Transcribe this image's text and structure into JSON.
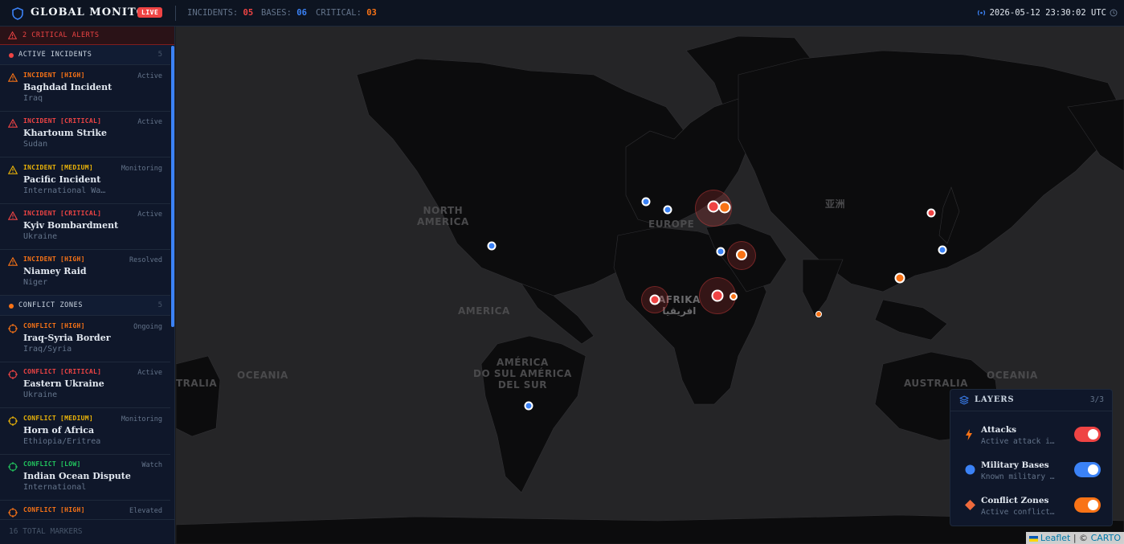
{
  "header": {
    "title": "GLOBAL MONITOR",
    "live": "LIVE",
    "stats": [
      {
        "label": "INCIDENTS:",
        "value": "05",
        "color": "#ef4444"
      },
      {
        "label": "BASES:",
        "value": "06",
        "color": "#3b82f6"
      },
      {
        "label": "CRITICAL:",
        "value": "03",
        "color": "#f97316"
      }
    ],
    "clock": "2026-05-12 23:30:02 UTC"
  },
  "sidebar": {
    "alerts": "2 CRITICAL ALERTS",
    "incidents_section": {
      "label": "ACTIVE INCIDENTS",
      "count": "5",
      "color": "#ef4444"
    },
    "incidents": [
      {
        "tag": "INCIDENT [HIGH]",
        "name": "Baghdad Incident",
        "loc": "Iraq",
        "status": "Active",
        "color": "#f97316"
      },
      {
        "tag": "INCIDENT [CRITICAL]",
        "name": "Khartoum Strike",
        "loc": "Sudan",
        "status": "Active",
        "color": "#ef4444"
      },
      {
        "tag": "INCIDENT [MEDIUM]",
        "name": "Pacific Incident",
        "loc": "International Wa…",
        "status": "Monitoring",
        "color": "#eab308"
      },
      {
        "tag": "INCIDENT [CRITICAL]",
        "name": "Kyiv Bombardment",
        "loc": "Ukraine",
        "status": "Active",
        "color": "#ef4444"
      },
      {
        "tag": "INCIDENT [HIGH]",
        "name": "Niamey Raid",
        "loc": "Niger",
        "status": "Resolved",
        "color": "#f97316"
      }
    ],
    "conflicts_section": {
      "label": "CONFLICT ZONES",
      "count": "5",
      "color": "#f97316"
    },
    "conflicts": [
      {
        "tag": "CONFLICT [HIGH]",
        "name": "Iraq-Syria Border",
        "loc": "Iraq/Syria",
        "status": "Ongoing",
        "color": "#f97316"
      },
      {
        "tag": "CONFLICT [CRITICAL]",
        "name": "Eastern Ukraine",
        "loc": "Ukraine",
        "status": "Active",
        "color": "#ef4444"
      },
      {
        "tag": "CONFLICT [MEDIUM]",
        "name": "Horn of Africa",
        "loc": "Ethiopia/Eritrea",
        "status": "Monitoring",
        "color": "#eab308"
      },
      {
        "tag": "CONFLICT [LOW]",
        "name": "Indian Ocean Dispute",
        "loc": "International",
        "status": "Watch",
        "color": "#22c55e"
      },
      {
        "tag": "CONFLICT [HIGH]",
        "name": "",
        "loc": "",
        "status": "Elevated",
        "color": "#f97316"
      }
    ],
    "footer": "16 TOTAL MARKERS"
  },
  "map": {
    "labels": {
      "north_america": "NORTH\nAMERICA",
      "europe": "EUROPE",
      "asia": "亚洲",
      "america": "AMERICA",
      "afrika": "AFRIKA\nافريقيا",
      "south_america": "AMÉRICA\nDO SUL AMÉRICA\nDEL SUR",
      "oceania_left": "OCEANIA",
      "australia_left": "TRALIA",
      "australia": "AUSTRALIA",
      "oceania_right": "OCEANIA"
    },
    "attribution": {
      "leaflet": "Leaflet",
      "sep": " | © ",
      "carto": "CARTO"
    }
  },
  "layers": {
    "title": "LAYERS",
    "count": "3/3",
    "items": [
      {
        "name": "Attacks",
        "desc": "Active attack i…",
        "on": true,
        "color": "#ef4444",
        "icon": "lightning-icon"
      },
      {
        "name": "Military Bases",
        "desc": "Known military …",
        "on": true,
        "color": "#3b82f6",
        "icon": "base-dot-icon"
      },
      {
        "name": "Conflict Zones",
        "desc": "Active conflict…",
        "on": true,
        "color": "#f97316",
        "icon": "diamond-icon"
      }
    ]
  }
}
